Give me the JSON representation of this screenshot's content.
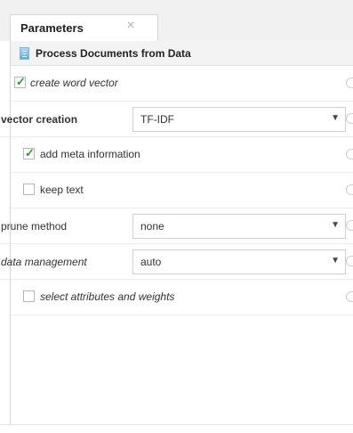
{
  "tab": {
    "label": "Parameters",
    "close_symbol": "×"
  },
  "operator": {
    "title": "Process Documents from Data",
    "icon": "document-icon"
  },
  "params": {
    "create_word_vector": {
      "label": "create word vector",
      "checked": true
    },
    "vector_creation": {
      "label": "vector creation",
      "value": "TF-IDF"
    },
    "add_meta_information": {
      "label": "add meta information",
      "checked": true
    },
    "keep_text": {
      "label": "keep text",
      "checked": false
    },
    "prune_method": {
      "label": "prune method",
      "value": "none"
    },
    "data_management": {
      "label": "data management",
      "value": "auto"
    },
    "select_attributes_and_weights": {
      "label": "select attributes and weights",
      "checked": false
    }
  },
  "dropdown_arrow": "▼"
}
